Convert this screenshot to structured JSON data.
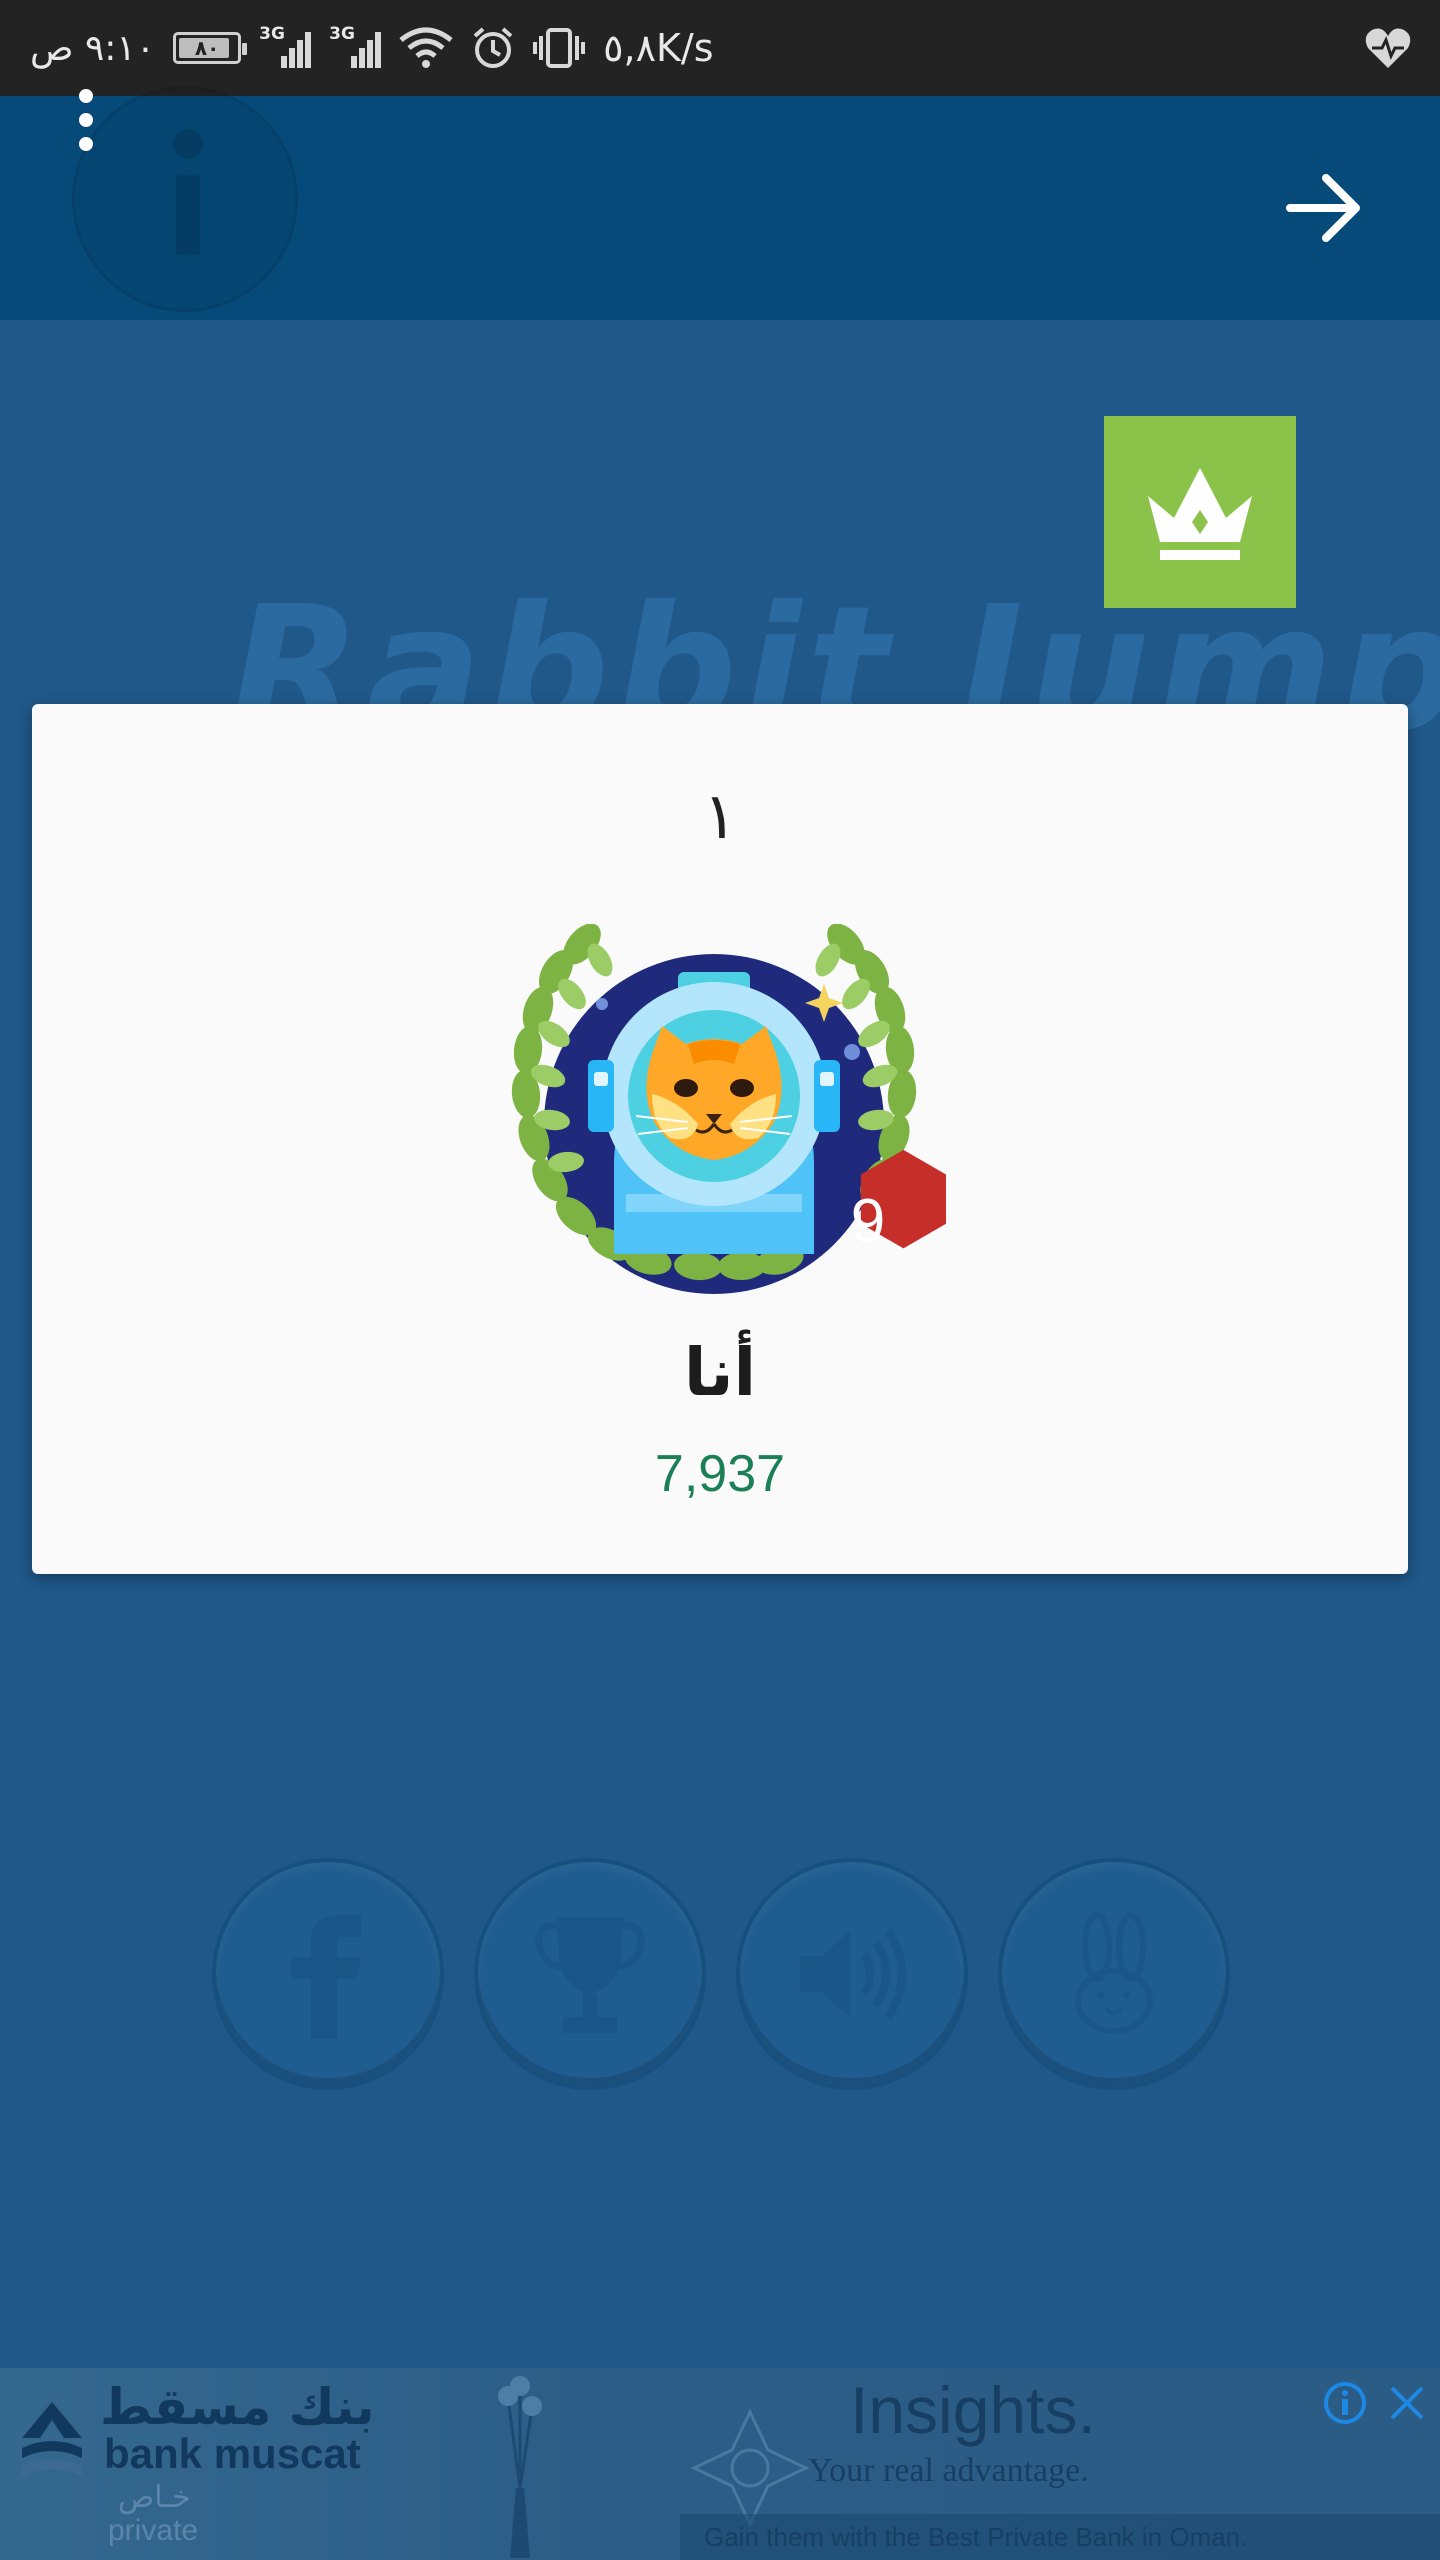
{
  "status_bar": {
    "time": "٩:١٠ ص",
    "battery": "٨٠",
    "battery_level": 0.8,
    "network_1": "3G",
    "network_2": "3G",
    "speed": "٥,٨K/s",
    "icons": [
      "battery-icon",
      "signal-icon",
      "wifi-icon",
      "alarm-icon",
      "vibrate-icon",
      "health-icon"
    ]
  },
  "app_bar": {
    "menu_icon": "more-vert-icon",
    "forward_icon": "arrow-forward-icon",
    "background_icon": "info-icon"
  },
  "background": {
    "title": "Rabbit Jump",
    "buttons": [
      "facebook-icon",
      "trophy-icon",
      "sound-icon",
      "rabbit-icon"
    ]
  },
  "leaderboard_card": {
    "rank": "١",
    "player_name": "أنا",
    "score": "7,937",
    "level_badge": "9"
  },
  "ad": {
    "bank_name_ar": "بنك مسقط",
    "bank_name_en": "bank muscat",
    "private_ar": "خـاص",
    "private_en": "private",
    "headline": "Insights.",
    "tagline": "Your real advantage.",
    "footer": "Gain them with the Best Private Bank in Oman."
  },
  "colors": {
    "status_bar": "#232323",
    "app_bar": "#064a7a",
    "background": "#20588a",
    "crown_button": "#8bc34a",
    "score": "#1b7f57",
    "badge": "#c62e2a"
  }
}
